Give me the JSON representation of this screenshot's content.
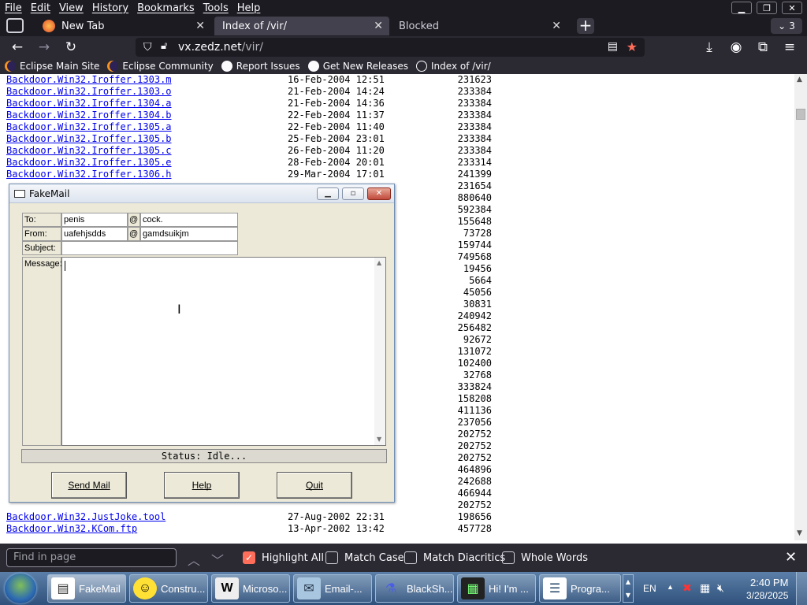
{
  "menus": [
    "File",
    "Edit",
    "View",
    "History",
    "Bookmarks",
    "Tools",
    "Help"
  ],
  "tabs": {
    "newtab": "New Tab",
    "index": "Index of /vir/",
    "blocked": "Blocked",
    "count": "3"
  },
  "url": {
    "host": "vx.zedz.net",
    "path": "/vir/"
  },
  "bookmarks": [
    "Eclipse Main Site",
    "Eclipse Community",
    "Report Issues",
    "Get New Releases",
    "Index of /vir/"
  ],
  "listing": {
    "rows": [
      {
        "name": "Backdoor.Win32.Iroffer.1303.m",
        "date": "16-Feb-2004 12:51",
        "size": "231623"
      },
      {
        "name": "Backdoor.Win32.Iroffer.1303.o",
        "date": "21-Feb-2004 14:24",
        "size": "233384"
      },
      {
        "name": "Backdoor.Win32.Iroffer.1304.a",
        "date": "21-Feb-2004 14:36",
        "size": "233384"
      },
      {
        "name": "Backdoor.Win32.Iroffer.1304.b",
        "date": "22-Feb-2004 11:37",
        "size": "233384"
      },
      {
        "name": "Backdoor.Win32.Iroffer.1305.a",
        "date": "22-Feb-2004 11:40",
        "size": "233384"
      },
      {
        "name": "Backdoor.Win32.Iroffer.1305.b",
        "date": "25-Feb-2004 23:01",
        "size": "233384"
      },
      {
        "name": "Backdoor.Win32.Iroffer.1305.c",
        "date": "26-Feb-2004 11:20",
        "size": "233384"
      },
      {
        "name": "Backdoor.Win32.Iroffer.1305.e",
        "date": "28-Feb-2004 20:01",
        "size": "233314"
      },
      {
        "name": "Backdoor.Win32.Iroffer.1306.h",
        "date": "29-Mar-2004 17:01",
        "size": "241399"
      }
    ],
    "hidden_sizes": [
      "231654",
      "880640",
      "592384",
      "155648",
      "73728",
      "159744",
      "749568",
      "19456",
      "5664",
      "45056",
      "30831",
      "240942",
      "256482",
      "92672",
      "131072",
      "102400",
      "32768",
      "333824",
      "158208",
      "411136",
      "237056",
      "202752",
      "202752",
      "202752",
      "464896",
      "242688",
      "466944",
      "202752"
    ],
    "tail_rows": [
      {
        "name": "Backdoor.Win32.JustJoke.tool",
        "date": "27-Aug-2002 22:31",
        "size": "198656"
      },
      {
        "name": "Backdoor.Win32.KCom.ftp",
        "date": "13-Apr-2002 13:42",
        "size": "457728"
      }
    ]
  },
  "fakemail": {
    "title": "FakeMail",
    "to_label": "To:",
    "to_user": "penis",
    "to_domain": "cock.",
    "from_label": "From:",
    "from_user": "uafehjsdds",
    "from_domain": "gamdsuikjm",
    "at": "@",
    "subject_label": "Subject:",
    "message_label": "Message:",
    "status": "Status: Idle...",
    "send_label": "Send Mail",
    "help_label": "Help",
    "quit_label": "Quit"
  },
  "findbar": {
    "placeholder": "Find in page",
    "highlight_all": "Highlight All",
    "match_case": "Match Case",
    "match_diacritics": "Match Diacritics",
    "whole_words": "Whole Words"
  },
  "taskbar": {
    "items": [
      "FakeMail",
      "Constru...",
      "Microso...",
      "Email-...",
      "BlackSh...",
      "Hi! I'm ...",
      "Progra..."
    ],
    "lang": "EN",
    "time": "2:40 PM",
    "date": "3/28/2025"
  },
  "colors": {
    "accent": "#ff6e5a",
    "link": "#0000ee"
  }
}
